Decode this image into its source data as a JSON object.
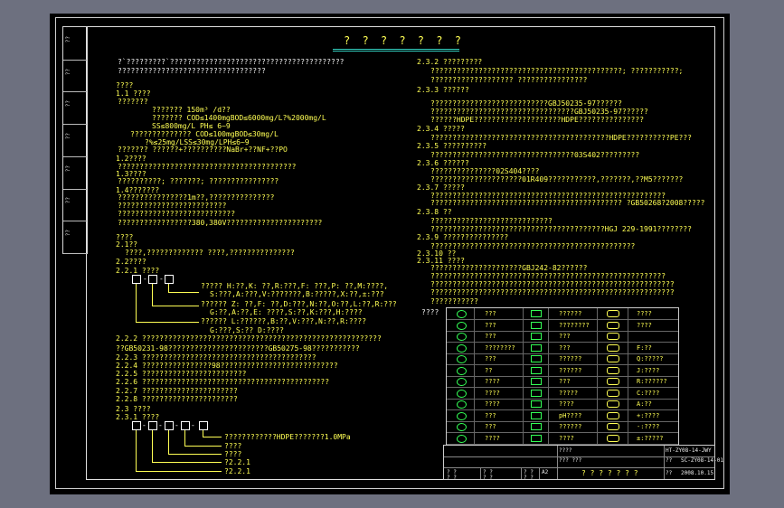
{
  "drawing": {
    "title": "? ? ? ? ? ? ?",
    "side_labels": [
      "??",
      "??",
      "??",
      "??",
      "??",
      "??",
      "??"
    ],
    "left_lines": [
      {
        "text": "?`?????????`????????????????????????????????????????",
        "c": "w"
      },
      {
        "text": "??????????????????????????????????",
        "c": "w"
      },
      {
        "text": "????",
        "c": "y"
      },
      {
        "text": "1.1  ????",
        "c": "y"
      },
      {
        "text": "???????",
        "c": "y"
      },
      {
        "text": "???????  150m³ /d??",
        "c": "y"
      },
      {
        "text": "???????    COD≤1400mgBOD≤6000mg/L?%2000mg/L",
        "c": "y"
      },
      {
        "text": "SS≤800mg/L  PH≤ 6~9",
        "c": "y"
      },
      {
        "text": "??????????????    COD≤100mgBOD≤30mg/L",
        "c": "y"
      },
      {
        "text": "?%≤25mg/LSS≤30mg/LPH≤6~9",
        "c": "y"
      },
      {
        "text": "???????   ??????+??????????NaBr+??NF+??PO",
        "c": "y"
      },
      {
        "text": "1.2????",
        "c": "y"
      },
      {
        "text": "?????????????????????????????????????????",
        "c": "y"
      },
      {
        "text": "1.3????",
        "c": "y"
      },
      {
        "text": "??????????;   ???????;  ????????????????",
        "c": "y"
      },
      {
        "text": "1.4???????",
        "c": "y"
      },
      {
        "text": "????????????????1m??,???????????????",
        "c": "y"
      },
      {
        "text": "?????????????????????????",
        "c": "y"
      },
      {
        "text": "???????????????????????????",
        "c": "y"
      },
      {
        "text": "?????????????????380,380V??????????????????????",
        "c": "y"
      },
      {
        "text": "????",
        "c": "y"
      },
      {
        "text": "2.1??",
        "c": "y"
      },
      {
        "text": "????,?????????????  ????,???????????????",
        "c": "y"
      },
      {
        "text": "2.2????",
        "c": "y"
      },
      {
        "text": "2.2.1  ????",
        "c": "y"
      }
    ],
    "code_legend_1": [
      "?????    H:??,K: ??,R:???,F: ???,P: ??,M:????,",
      "S:???,A:???,V:???????,B:?????,X:??,±:???",
      "??????    Z: ??,F: ??,D:???,N:??,O:??,L:??,R:???",
      "G:??,A:??,E: ????,S:??,K:???,H:????",
      "??????    L:??????,B:??,V:???,N:??,R:????",
      "G:???,S:??    D:????"
    ],
    "left_lines_2": [
      "2.2.2  ???????????????????????????????????????????????????????",
      "??GB50231-98???????????????????????GB50275-98???????????",
      "2.2.3  ????????????????????????????????????????",
      "2.2.4  ????????????????98???????????????????????????",
      "2.2.5  ????????????????????????",
      "2.2.6  ???????????????????????????????????????????",
      "2.2.7  ??????????????????????",
      "2.2.8  ??????????????????????",
      "2.3  ????",
      "2.3.1  ????"
    ],
    "code_legend_2": [
      "????????????HDPE???????1.0MPa",
      "????",
      "????",
      "?2.2.1",
      "?2.2.1"
    ],
    "right_lines": [
      "2.3.2  ?????????",
      "????????????????????????????????????????????;       ???????????;",
      "???????????????????       ????????????????",
      "2.3.3  ??????",
      "???????????????????????????GBJ50235-97??????",
      "?????????????????????????????????GBJ50235-97??????",
      "??????HDPE????????????????????HDPE???????????????",
      "2.3.4  ?????",
      "?????????????????????????????????????????HDPE??????????PE???",
      "2.3.5  ??????????",
      "?????????????????????????????????03S402?????????",
      "2.3.6  ??????",
      "???????????????02S404????",
      "?????????????????????01R409???????????,???????,??M5???????",
      "2.3.7  ?????",
      "??????????????????????????????????????????????????????",
      "????????????????????????????????????????????     ?GB50268?2008?????",
      "2.3.8  ??",
      "????????????????????????????",
      "????????????????????????????????????????HGJ 229-1991????????",
      "2.3.9  ???????????????",
      "???????????????????????????????????????????????",
      "2.3.10  ??",
      "2.3.11  ????",
      "?????????????????????GBJ242-82??????",
      "??????????????????????????????????????????????????????",
      "????????????????????????????????????????????????????????",
      "????????????????????????????????????????????????????????",
      "???????????"
    ],
    "legend_label": "????",
    "legend_rows": [
      {
        "a": "???",
        "b": "??????",
        "c": "????"
      },
      {
        "a": "???",
        "b": "????????",
        "c": "????"
      },
      {
        "a": "???",
        "b": "???",
        "c": ""
      },
      {
        "a": "????????",
        "b": "???",
        "c": "F:??"
      },
      {
        "a": "???",
        "b": "??????",
        "c": "Q:?????"
      },
      {
        "a": "??",
        "b": "??????",
        "c": "J:????"
      },
      {
        "a": "????",
        "b": "???",
        "c": "R:??????"
      },
      {
        "a": "????",
        "b": "?????",
        "c": "C:????"
      },
      {
        "a": "????",
        "b": "????",
        "c": "A:??"
      },
      {
        "a": "???",
        "b": "pH????",
        "c": "+:????"
      },
      {
        "a": "???",
        "b": "??????",
        "c": "-:????"
      },
      {
        "a": "????",
        "b": "????",
        "c": "±:?????"
      }
    ],
    "title_block": {
      "main": "? ? ? ? ? ? ?",
      "designer": "????",
      "checker": "??? ???",
      "drawing_no": "SC-ZY08-14-01",
      "code": "HT-ZY08-14-JWY",
      "scale": "??",
      "sheet": "??",
      "date": "2008.10.15",
      "row_a": [
        "? ?",
        "? ?",
        "? ?",
        "A2"
      ],
      "row_b": [
        "? ?",
        "? ?",
        "? ?",
        ""
      ]
    }
  }
}
